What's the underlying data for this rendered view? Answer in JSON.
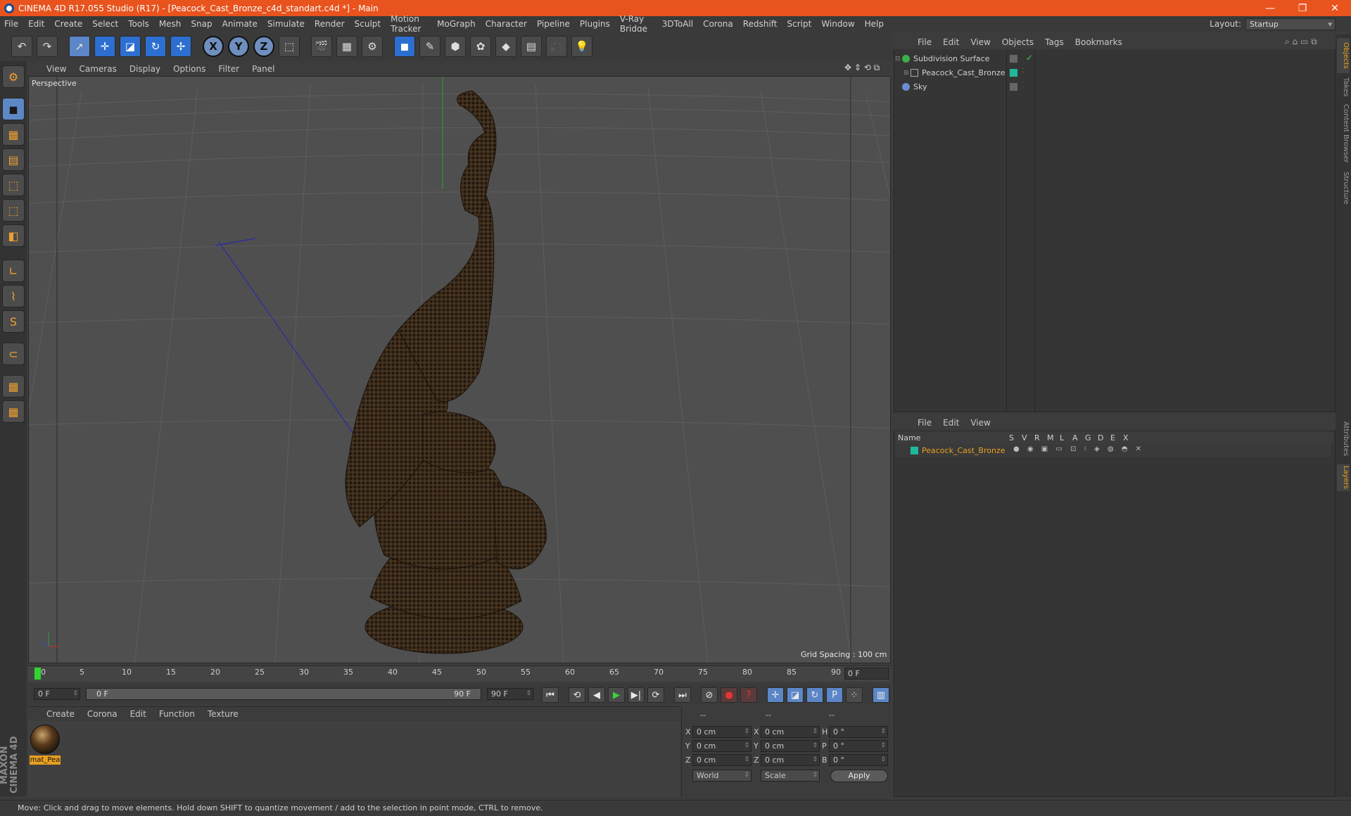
{
  "window": {
    "title": "CINEMA 4D R17.055 Studio (R17) - [Peacock_Cast_Bronze_c4d_standart.c4d *] - Main",
    "minimize": "—",
    "restore": "❐",
    "close": "✕"
  },
  "menu": [
    "File",
    "Edit",
    "Create",
    "Select",
    "Tools",
    "Mesh",
    "Snap",
    "Animate",
    "Simulate",
    "Render",
    "Sculpt",
    "Motion Tracker",
    "MoGraph",
    "Character",
    "Pipeline",
    "Plugins",
    "V-Ray Bridge",
    "3DToAll",
    "Corona",
    "Redshift",
    "Script",
    "Window",
    "Help"
  ],
  "layout": {
    "label": "Layout:",
    "value": "Startup"
  },
  "viewport": {
    "menu": [
      "View",
      "Cameras",
      "Display",
      "Options",
      "Filter",
      "Panel"
    ],
    "label": "Perspective",
    "grid_spacing": "Grid Spacing : 100 cm"
  },
  "timeline": {
    "ticks": [
      "0",
      "5",
      "10",
      "15",
      "20",
      "25",
      "30",
      "35",
      "40",
      "45",
      "50",
      "55",
      "60",
      "65",
      "70",
      "75",
      "80",
      "85",
      "90"
    ],
    "current_frame": "0 F",
    "start_field": "0 F",
    "range_start": "0 F",
    "range_end": "90 F",
    "end_field": "90 F"
  },
  "material_editor": {
    "menu": [
      "Create",
      "Corona",
      "Edit",
      "Function",
      "Texture"
    ],
    "materials": [
      {
        "name": "mat_Pea"
      }
    ]
  },
  "coordinates": {
    "headers": [
      "--",
      "--",
      "--"
    ],
    "rows": [
      {
        "a": "X",
        "av": "0 cm",
        "b": "X",
        "bv": "0 cm",
        "c": "H",
        "cv": "0 °"
      },
      {
        "a": "Y",
        "av": "0 cm",
        "b": "Y",
        "bv": "0 cm",
        "c": "P",
        "cv": "0 °"
      },
      {
        "a": "Z",
        "av": "0 cm",
        "b": "Z",
        "bv": "0 cm",
        "c": "B",
        "cv": "0 °"
      }
    ],
    "mode1": "World",
    "mode2": "Scale",
    "apply": "Apply"
  },
  "object_manager": {
    "menu": [
      "File",
      "Edit",
      "View",
      "Objects",
      "Tags",
      "Bookmarks"
    ],
    "objects": [
      {
        "name": "Subdivision Surface",
        "color": "#3ab04a"
      },
      {
        "name": "Peacock_Cast_Bronze",
        "color": "#1fb89a"
      },
      {
        "name": "Sky",
        "color": "#6a8fd0"
      }
    ]
  },
  "layer_manager": {
    "menu": [
      "File",
      "Edit",
      "View"
    ],
    "columns": [
      "Name",
      "S",
      "V",
      "R",
      "M",
      "L",
      "A",
      "G",
      "D",
      "E",
      "X"
    ],
    "layers": [
      {
        "name": "Peacock_Cast_Bronze",
        "color": "#1fb89a"
      }
    ]
  },
  "side_tabs": [
    "Objects",
    "Takes",
    "Content Browser",
    "Structure",
    "Attributes",
    "Layers"
  ],
  "status": "Move: Click and drag to move elements. Hold down SHIFT to quantize movement / add to the selection in point mode, CTRL to remove.",
  "brand": "MAXON CINEMA 4D"
}
